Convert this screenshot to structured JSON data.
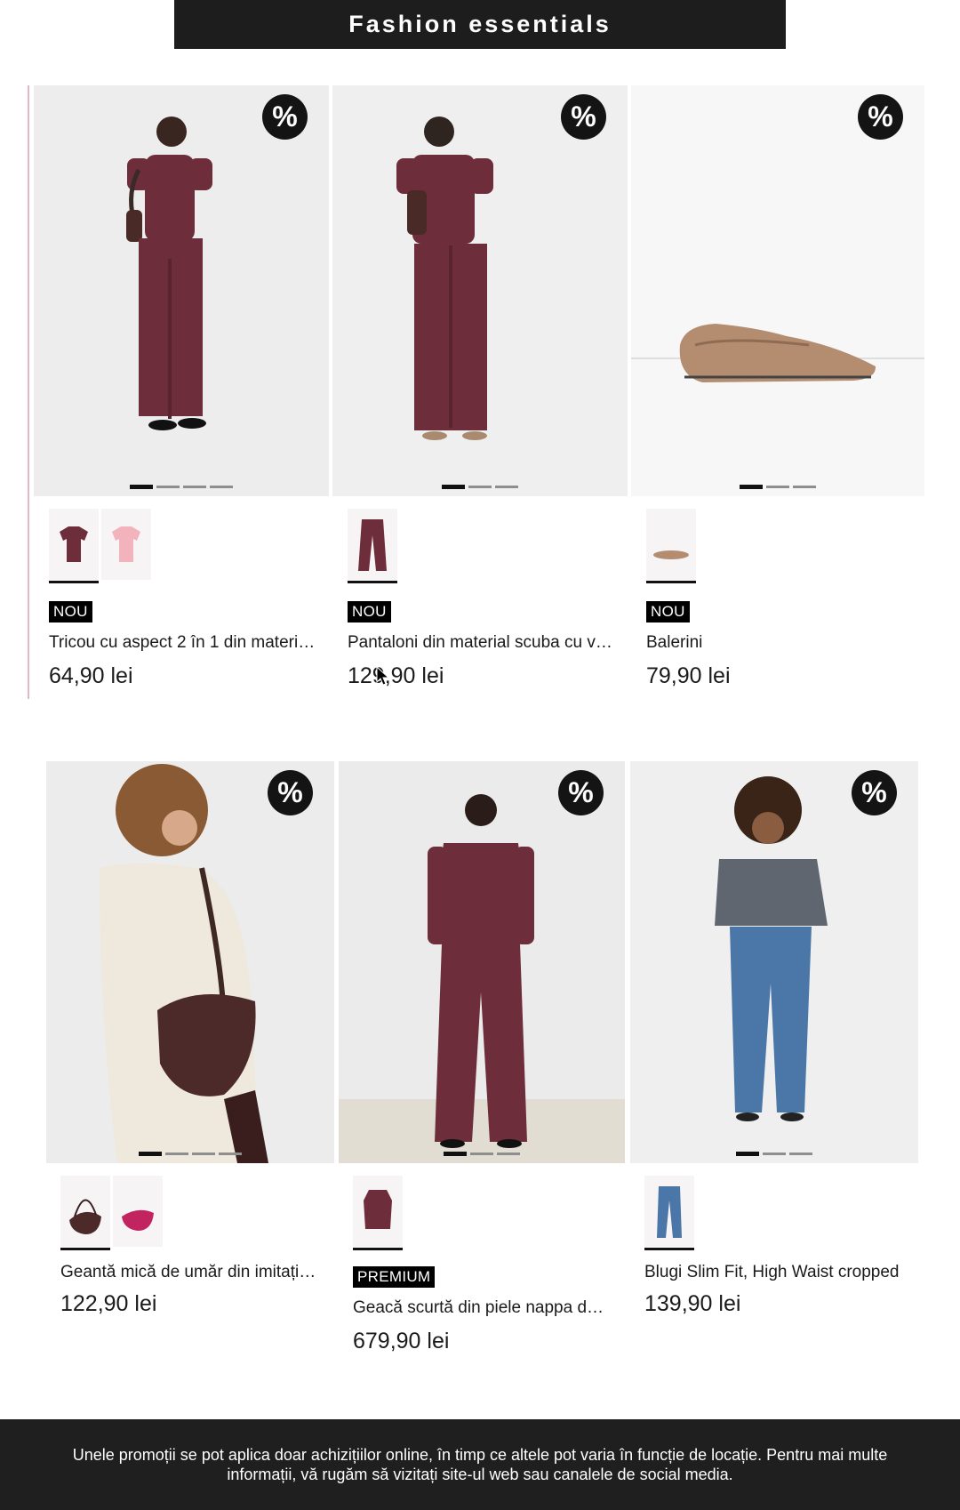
{
  "header": {
    "title": "Fashion essentials"
  },
  "products": [
    {
      "title": "Tricou cu aspect 2 în 1 din materi…",
      "price": "64,90 lei",
      "tag": "NOU",
      "discount_icon": "%",
      "swatch_count": 2,
      "image_dots": 4,
      "active_dot": 1
    },
    {
      "title": "Pantaloni din material scuba cu vi…",
      "price": "129,90 lei",
      "tag": "NOU",
      "discount_icon": "%",
      "swatch_count": 1,
      "image_dots": 3,
      "active_dot": 1
    },
    {
      "title": "Balerini",
      "price": "79,90 lei",
      "tag": "NOU",
      "discount_icon": "%",
      "swatch_count": 1,
      "image_dots": 3,
      "active_dot": 1
    },
    {
      "title": "Geantă mică de umăr din imitație …",
      "price": "122,90 lei",
      "tag": "",
      "discount_icon": "%",
      "swatch_count": 2,
      "image_dots": 4,
      "active_dot": 1
    },
    {
      "title": "Geacă scurtă din piele nappa de …",
      "price": "679,90 lei",
      "tag": "PREMIUM",
      "discount_icon": "%",
      "swatch_count": 1,
      "image_dots": 3,
      "active_dot": 1
    },
    {
      "title": "Blugi Slim Fit, High Waist cropped",
      "price": "139,90 lei",
      "tag": "",
      "discount_icon": "%",
      "swatch_count": 1,
      "image_dots": 3,
      "active_dot": 1
    }
  ],
  "footer": {
    "text": "Unele promoții se pot aplica doar achizițiilor online, în timp ce altele pot varia în funcție de locație. Pentru mai multe informații, vă rugăm să vizitați site-ul web sau canalele de social media."
  },
  "colors": {
    "accent_line": "#e2b7bf",
    "burgundy": "#6e2d3a",
    "pink": "#f2b3bd",
    "header_bg": "#1d1d1d"
  }
}
